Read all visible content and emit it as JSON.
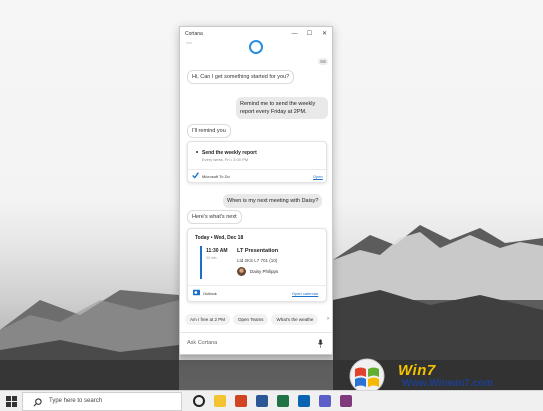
{
  "window": {
    "title": "Cortana",
    "minimize_glyph": "—",
    "maximize_glyph": "☐",
    "close_glyph": "✕",
    "menu_glyph": "⋯"
  },
  "conversation": {
    "greeting": "Hi, Can I get something started for you?",
    "user_message_1": "Remind me to send the weekly report every Friday at 2PM.",
    "reply_1": "I'll remind you",
    "user_message_2": "When is my next meeting with Daisy?",
    "reply_2": "Here's what's next"
  },
  "todo_card": {
    "item_title": "Send the weekly report",
    "item_subtitle": "Every week, Fri • 2:00 PM",
    "app_name": "Microsoft To Do",
    "action_link": "Open",
    "app_icon": "check-icon",
    "accent": "#1a6fc9"
  },
  "calendar_card": {
    "header": "Today • Wed, Dec 18",
    "time": "11:30 AM",
    "duration": "30 min",
    "event_title": "LT Presentation",
    "location": "Ltd 2KS L7 701 (10)",
    "attendee": "Daisy Philipps",
    "app_name": "Outlook",
    "action_link": "Open calendar",
    "accent": "#1a6fc9"
  },
  "suggestions": [
    "Am I free at 2 PM",
    "Open Teams",
    "What's the weathe"
  ],
  "ask_bar": {
    "placeholder": "Ask Cortana",
    "mic_icon": "microphone-icon"
  },
  "taskbar": {
    "search_placeholder": "Type here to search",
    "icons": [
      "windows-start-icon",
      "search-icon",
      "cortana-icon",
      "file-explorer-icon",
      "powerpoint-icon",
      "word-icon",
      "excel-icon",
      "outlook-icon",
      "teams-icon",
      "onenote-icon",
      "mail-icon"
    ]
  },
  "watermark": {
    "brand": "Win7",
    "url": "Www.Winwin7.com"
  }
}
